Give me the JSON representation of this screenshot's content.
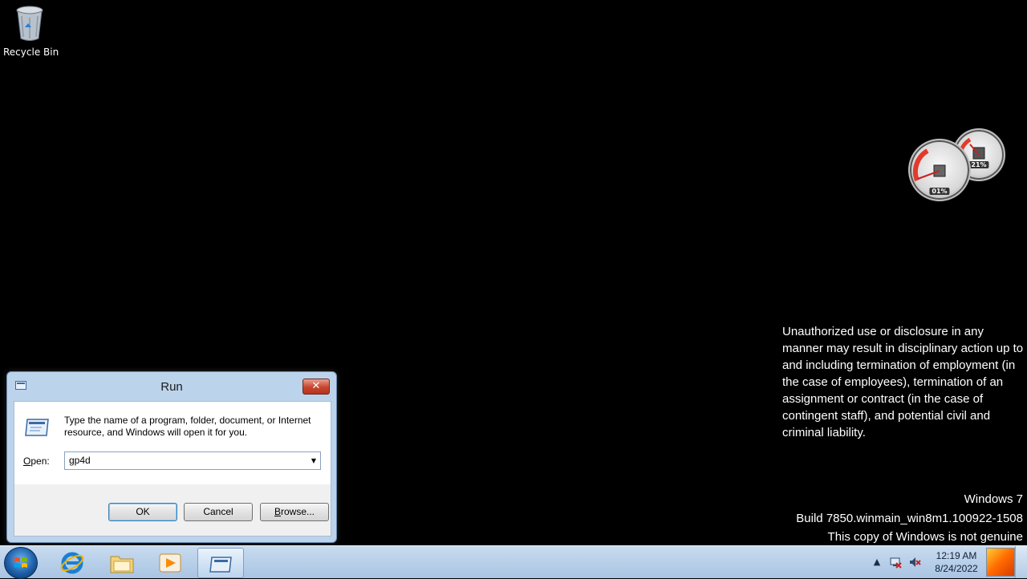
{
  "desktop": {
    "icons": [
      {
        "label": "Recycle Bin",
        "icon": "recycle-bin-icon"
      }
    ]
  },
  "gadgets": {
    "cpu_meter": {
      "left_gauge_label": "01%",
      "right_gauge_label": "21%"
    }
  },
  "legal_notice": "Unauthorized use or disclosure in any manner may result in disciplinary action up to and including termination of employment (in the case of employees), termination of an assignment or contract (in the case of contingent staff), and potential civil and criminal liability.",
  "watermark": {
    "line1": "Windows 7",
    "line2": "Build 7850.winmain_win8m1.100922-1508",
    "line3": "This copy of Windows is not genuine"
  },
  "run_dialog": {
    "title": "Run",
    "close_glyph": "✕",
    "description": "Type the name of a program, folder, document, or Internet resource, and Windows will open it for you.",
    "open_label_prefix": "",
    "open_label_access": "O",
    "open_label_rest": "pen:",
    "open_value": "gp4d",
    "ok_label": "OK",
    "cancel_label": "Cancel",
    "browse_label_access": "B",
    "browse_label_rest": "rowse..."
  },
  "taskbar": {
    "apps": [
      {
        "name": "internet-explorer",
        "icon": "ie-icon"
      },
      {
        "name": "windows-explorer",
        "icon": "folder-icon"
      },
      {
        "name": "media-player",
        "icon": "media-player-icon"
      },
      {
        "name": "run",
        "icon": "run-icon",
        "active": true
      }
    ],
    "tray": {
      "overflow_glyph": "▲",
      "time": "12:19 AM",
      "date": "8/24/2022"
    }
  },
  "colors": {
    "desktop_background": "#000000",
    "taskbar": "#b9d0ea",
    "dialog_frame": "#bcd3ec",
    "close_button": "#c8452f"
  }
}
